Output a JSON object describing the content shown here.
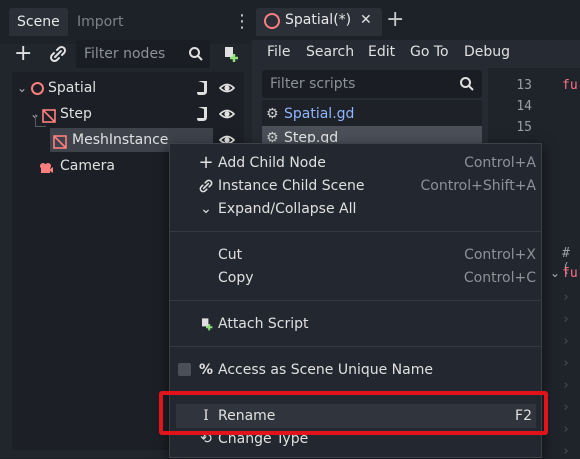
{
  "scene_dock": {
    "tabs": [
      "Scene",
      "Import"
    ],
    "filter_placeholder": "Filter nodes",
    "tree": [
      {
        "label": "Spatial",
        "icon": "spatial-node-icon"
      },
      {
        "label": "Step",
        "icon": "mesh-instance-icon"
      },
      {
        "label": "MeshInstance",
        "icon": "mesh-instance-icon"
      },
      {
        "label": "Camera",
        "icon": "camera-icon"
      }
    ]
  },
  "script_editor": {
    "tab_label": "Spatial(*)",
    "close_glyph": "✕",
    "add_glyph": "+",
    "menu": [
      "File",
      "Search",
      "Edit",
      "Go To",
      "Debug"
    ],
    "filter_placeholder": "Filter scripts",
    "scripts": [
      "Spatial.gd",
      "Step.gd"
    ],
    "line_numbers": [
      "13",
      "14",
      "15"
    ],
    "code_fragments": {
      "fu1": "fu",
      "comment": "# (",
      "fu2": "fu"
    }
  },
  "context_menu": {
    "items": [
      {
        "label": "Add Child Node",
        "shortcut": "Control+A",
        "icon": "+"
      },
      {
        "label": "Instance Child Scene",
        "shortcut": "Control+Shift+A",
        "icon": "🔗"
      },
      {
        "label": "Expand/Collapse All",
        "shortcut": "",
        "icon": "⌄"
      },
      {
        "label": "Cut",
        "shortcut": "Control+X",
        "icon": ""
      },
      {
        "label": "Copy",
        "shortcut": "Control+C",
        "icon": ""
      },
      {
        "label": "Attach Script",
        "shortcut": "",
        "icon": "script"
      },
      {
        "label": "Access as Scene Unique Name",
        "shortcut": "",
        "icon": "%"
      },
      {
        "label": "Rename",
        "shortcut": "F2",
        "icon": "I"
      },
      {
        "label": "Change Type",
        "shortcut": "",
        "icon": "⟲"
      }
    ]
  },
  "colors": {
    "highlight_box": "#e2141b",
    "spatial_icon": "#fc7f7f",
    "script_link": "#8fb5ff"
  }
}
